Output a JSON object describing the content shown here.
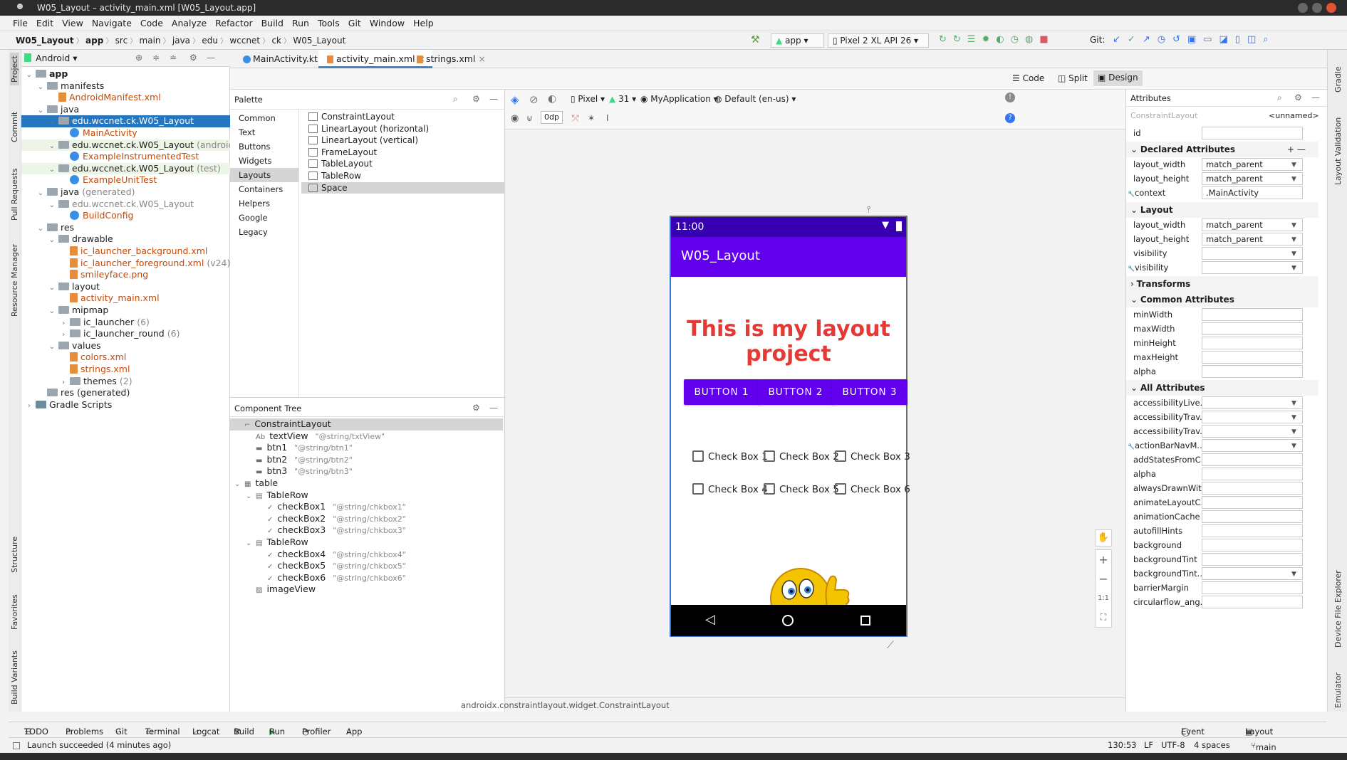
{
  "window": {
    "title": "W05_Layout – activity_main.xml [W05_Layout.app]"
  },
  "menu": [
    "File",
    "Edit",
    "View",
    "Navigate",
    "Code",
    "Analyze",
    "Refactor",
    "Build",
    "Run",
    "Tools",
    "Git",
    "Window",
    "Help"
  ],
  "breadcrumb": [
    "W05_Layout",
    "app",
    "src",
    "main",
    "java",
    "edu",
    "wccnet",
    "ck",
    "W05_Layout"
  ],
  "toolbar": {
    "run_config": "app",
    "device": "Pixel 2 XL API 26",
    "git_label": "Git:"
  },
  "left_strip": [
    "Project",
    "Commit",
    "Pull Requests",
    "Resource Manager",
    "Structure",
    "Favorites",
    "Build Variants"
  ],
  "right_strip": [
    "Gradle",
    "Layout Validation",
    "Device File Explorer",
    "Emulator"
  ],
  "project": {
    "view": "Android",
    "tree": [
      {
        "label": "app",
        "bold": true
      },
      {
        "label": "manifests"
      },
      {
        "label": "AndroidManifest.xml"
      },
      {
        "label": "java"
      },
      {
        "label": "edu.wccnet.ck.W05_Layout"
      },
      {
        "label": "MainActivity"
      },
      {
        "label": "edu.wccnet.ck.W05_Layout",
        "suffix": "(androidTe"
      },
      {
        "label": "ExampleInstrumentedTest"
      },
      {
        "label": "edu.wccnet.ck.W05_Layout",
        "suffix": "(test)"
      },
      {
        "label": "ExampleUnitTest"
      },
      {
        "label": "java",
        "suffix": "(generated)"
      },
      {
        "label": "edu.wccnet.ck.W05_Layout"
      },
      {
        "label": "BuildConfig"
      },
      {
        "label": "res"
      },
      {
        "label": "drawable"
      },
      {
        "label": "ic_launcher_background.xml"
      },
      {
        "label": "ic_launcher_foreground.xml",
        "suffix": "(v24)"
      },
      {
        "label": "smileyface.png"
      },
      {
        "label": "layout"
      },
      {
        "label": "activity_main.xml"
      },
      {
        "label": "mipmap"
      },
      {
        "label": "ic_launcher",
        "suffix": "(6)"
      },
      {
        "label": "ic_launcher_round",
        "suffix": "(6)"
      },
      {
        "label": "values"
      },
      {
        "label": "colors.xml"
      },
      {
        "label": "strings.xml"
      },
      {
        "label": "themes",
        "suffix": "(2)"
      },
      {
        "label": "res (generated)"
      },
      {
        "label": "Gradle Scripts"
      }
    ]
  },
  "tabs": [
    "MainActivity.kt",
    "activity_main.xml",
    "strings.xml"
  ],
  "view_modes": {
    "code": "Code",
    "split": "Split",
    "design": "Design"
  },
  "palette": {
    "title": "Palette",
    "categories": [
      "Common",
      "Text",
      "Buttons",
      "Widgets",
      "Layouts",
      "Containers",
      "Helpers",
      "Google",
      "Legacy"
    ],
    "items": [
      "ConstraintLayout",
      "LinearLayout (horizontal)",
      "LinearLayout (vertical)",
      "FrameLayout",
      "TableLayout",
      "TableRow",
      "Space"
    ]
  },
  "design_toolbar": {
    "device": "Pixel",
    "api": "31",
    "theme": "MyApplication",
    "locale": "Default (en-us)",
    "margin": "0dp"
  },
  "component_tree": {
    "title": "Component Tree",
    "items": [
      {
        "name": "ConstraintLayout",
        "ref": ""
      },
      {
        "name": "textView",
        "ref": "\"@string/txtView\""
      },
      {
        "name": "btn1",
        "ref": "\"@string/btn1\""
      },
      {
        "name": "btn2",
        "ref": "\"@string/btn2\""
      },
      {
        "name": "btn3",
        "ref": "\"@string/btn3\""
      },
      {
        "name": "table",
        "ref": ""
      },
      {
        "name": "TableRow",
        "ref": ""
      },
      {
        "name": "checkBox1",
        "ref": "\"@string/chkbox1\""
      },
      {
        "name": "checkBox2",
        "ref": "\"@string/chkbox2\""
      },
      {
        "name": "checkBox3",
        "ref": "\"@string/chkbox3\""
      },
      {
        "name": "TableRow",
        "ref": ""
      },
      {
        "name": "checkBox4",
        "ref": "\"@string/chkbox4\""
      },
      {
        "name": "checkBox5",
        "ref": "\"@string/chkbox5\""
      },
      {
        "name": "checkBox6",
        "ref": "\"@string/chkbox6\""
      },
      {
        "name": "imageView",
        "ref": ""
      }
    ]
  },
  "phone": {
    "time": "11:00",
    "app_title": "W05_Layout",
    "heading": "This is my layout project",
    "buttons": [
      "BUTTON 1",
      "BUTTON 2",
      "BUTTON 3"
    ],
    "checkboxes": [
      "Check Box 1",
      "Check Box 2",
      "Check Box 3",
      "Check Box 4",
      "Check Box 5",
      "Check Box 6"
    ]
  },
  "attributes": {
    "title": "Attributes",
    "component": "ConstraintLayout",
    "unnamed": "<unnamed>",
    "id_label": "id",
    "declared_title": "Declared Attributes",
    "declared": [
      {
        "k": "layout_width",
        "v": "match_parent"
      },
      {
        "k": "layout_height",
        "v": "match_parent"
      },
      {
        "k": "context",
        "v": ".MainActivity"
      }
    ],
    "layout_title": "Layout",
    "layout": [
      {
        "k": "layout_width",
        "v": "match_parent"
      },
      {
        "k": "layout_height",
        "v": "match_parent"
      },
      {
        "k": "visibility",
        "v": ""
      },
      {
        "k": "visibility",
        "v": ""
      }
    ],
    "transforms_title": "Transforms",
    "common_title": "Common Attributes",
    "common": [
      "minWidth",
      "maxWidth",
      "minHeight",
      "maxHeight",
      "alpha"
    ],
    "all_title": "All Attributes",
    "all": [
      "accessibilityLive...",
      "accessibilityTrav...",
      "accessibilityTrav...",
      "actionBarNavM...",
      "addStatesFromC...",
      "alpha",
      "alwaysDrawnWit...",
      "animateLayoutC...",
      "animationCache",
      "autofillHints",
      "background",
      "backgroundTint",
      "backgroundTint...",
      "barrierMargin",
      "circularflow_ang..."
    ]
  },
  "class_path": "androidx.constraintlayout.widget.ConstraintLayout",
  "bottom_tools": [
    "TODO",
    "Problems",
    "Git",
    "Terminal",
    "Logcat",
    "Build",
    "Run",
    "Profiler",
    "App Inspection"
  ],
  "bottom_right": [
    "Event Log",
    "Layout Inspector"
  ],
  "status": {
    "message": "Launch succeeded (4 minutes ago)",
    "position": "130:53",
    "line_sep": "LF",
    "encoding": "UTF-8",
    "indent": "4 spaces",
    "branch": "main"
  }
}
